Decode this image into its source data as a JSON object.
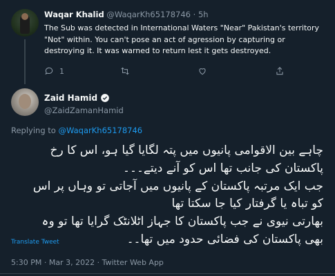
{
  "reply": {
    "name": "Waqar Khalid",
    "handle": "@WaqarKh65178746",
    "separator": "·",
    "time": "5h",
    "text": "The Sub was detected in International Waters \"Near\" Pakistan's territory \"Not\" within. You can't pose an act of agression by capturing or destroying it. It was warned to return lest it gets destroyed.",
    "reply_count": "1",
    "avatar_icon": "user-photo-icon"
  },
  "main": {
    "name": "Zaid Hamid",
    "handle": "@ZaidZamanHamid",
    "verified_icon": "verified-badge-icon",
    "replying_prefix": "Replying to",
    "replying_handle": "@WaqarKh65178746",
    "urdu_lines": [
      "چاہے بین الاقوامی پانیوں میں پتہ لگایا گیا ہو، اس کا رخ",
      "پاکستان کی جانب تھا اس کو آنے دیتے۔۔۔",
      "جب ایک مرتبہ پاکستان کے پانیوں میں آجاتی تو وہاں پر اس",
      "کو تباہ یا گرفتار کیا جا سکتا تھا",
      "بھارتی نیوی نے جب پاکستان کا جہاز اٹلانٹک گرایا تھا تو وہ",
      "بھی پاکستان کی فضائی حدود میں تھا۔۔"
    ],
    "translate_label": "Translate Tweet",
    "time": "5:30 PM",
    "date": "Mar 3, 2022",
    "source": "Twitter Web App",
    "meta_separator": "·"
  },
  "colors": {
    "background": "#15202b",
    "text": "#f7f9f9",
    "muted": "#8b98a5",
    "accent": "#1d9bf0",
    "border": "#38444d"
  }
}
